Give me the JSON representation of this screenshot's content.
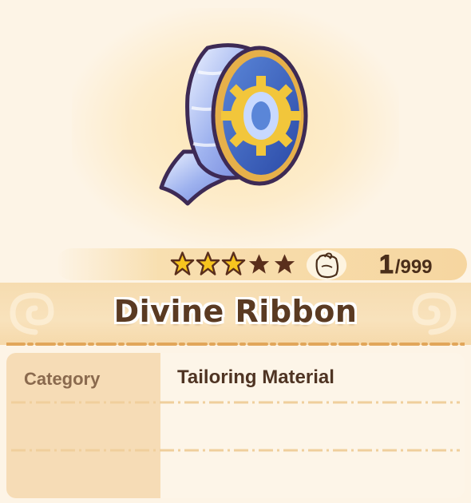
{
  "item": {
    "name": "Divine Ribbon",
    "icon": "ribbon-spool-icon",
    "rarity_stars_filled": 3,
    "rarity_stars_total": 5,
    "owned_count": "1",
    "max_count": "/999"
  },
  "info": {
    "rows": [
      {
        "label": "Category",
        "value": "Tailoring Material"
      },
      {
        "label": "",
        "value": ""
      },
      {
        "label": "",
        "value": ""
      }
    ]
  },
  "colors": {
    "star_filled": "#f7c51e",
    "star_empty": "#5a2f1c",
    "title_text": "#5a3a22",
    "label_text": "#8a6a4e",
    "value_text": "#4f3423"
  }
}
